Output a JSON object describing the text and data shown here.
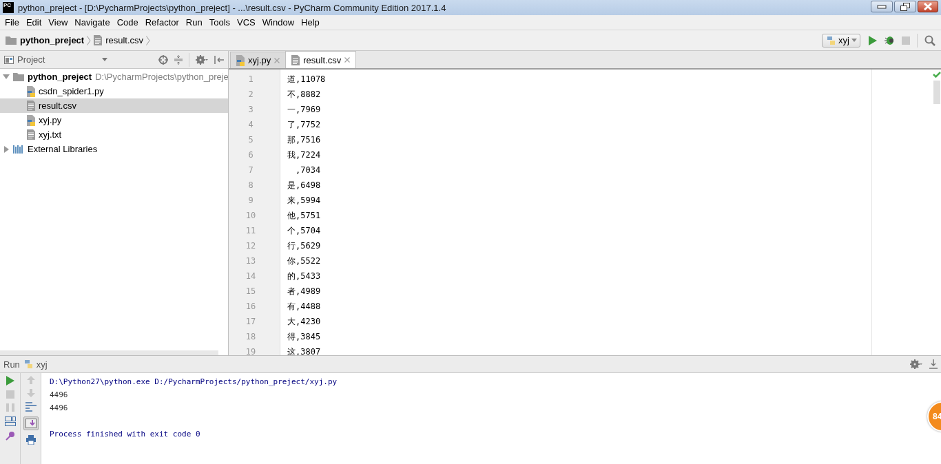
{
  "app_logo": {
    "text": "PC"
  },
  "window": {
    "title": "python_preject - [D:\\PycharmProjects\\python_preject] - ...\\result.csv - PyCharm Community Edition 2017.1.4"
  },
  "menu": [
    {
      "label": "File"
    },
    {
      "label": "Edit"
    },
    {
      "label": "View"
    },
    {
      "label": "Navigate"
    },
    {
      "label": "Code"
    },
    {
      "label": "Refactor"
    },
    {
      "label": "Run"
    },
    {
      "label": "Tools"
    },
    {
      "label": "VCS"
    },
    {
      "label": "Window"
    },
    {
      "label": "Help"
    }
  ],
  "breadcrumbs": [
    {
      "label": "python_preject",
      "kind": "folder"
    },
    {
      "label": "result.csv",
      "kind": "text"
    }
  ],
  "run_config": {
    "label": "xyj"
  },
  "project_panel": {
    "title": "Project",
    "tree": [
      {
        "label": "python_preject",
        "path": "D:\\PycharmProjects\\python_preje",
        "kind": "folder",
        "expanded": true,
        "selected": false,
        "children": [
          {
            "label": "csdn_spider1.py",
            "kind": "python",
            "selected": false
          },
          {
            "label": "result.csv",
            "kind": "text",
            "selected": true
          },
          {
            "label": "xyj.py",
            "kind": "python",
            "selected": false
          },
          {
            "label": "xyj.txt",
            "kind": "text",
            "selected": false
          }
        ]
      },
      {
        "label": "External Libraries",
        "kind": "library",
        "expanded": false,
        "selected": false
      }
    ]
  },
  "editor": {
    "tabs": [
      {
        "label": "xyj.py",
        "kind": "python",
        "selected": false
      },
      {
        "label": "result.csv",
        "kind": "text",
        "selected": true
      }
    ],
    "lines": [
      {
        "number": "1",
        "text": "道,11078"
      },
      {
        "number": "2",
        "text": "不,8882"
      },
      {
        "number": "3",
        "text": "一,7969"
      },
      {
        "number": "4",
        "text": "了,7752"
      },
      {
        "number": "5",
        "text": "那,7516"
      },
      {
        "number": "6",
        "text": "我,7224"
      },
      {
        "number": "7",
        "text": "　,7034"
      },
      {
        "number": "8",
        "text": "是,6498"
      },
      {
        "number": "9",
        "text": "来,5994"
      },
      {
        "number": "10",
        "text": "他,5751"
      },
      {
        "number": "11",
        "text": "个,5704"
      },
      {
        "number": "12",
        "text": "行,5629"
      },
      {
        "number": "13",
        "text": "你,5522"
      },
      {
        "number": "14",
        "text": "的,5433"
      },
      {
        "number": "15",
        "text": "者,4989"
      },
      {
        "number": "16",
        "text": "有,4488"
      },
      {
        "number": "17",
        "text": "大,4230"
      },
      {
        "number": "18",
        "text": "得,3845"
      },
      {
        "number": "19",
        "text": "这,3807"
      }
    ]
  },
  "run_panel": {
    "title": "Run",
    "config": "xyj",
    "output": [
      {
        "kind": "command",
        "text": "D:\\Python27\\python.exe D:/PycharmProjects/python_preject/xyj.py"
      },
      {
        "kind": "stdout",
        "text": "4496"
      },
      {
        "kind": "stdout",
        "text": "4496"
      },
      {
        "kind": "system",
        "text": "Process finished with exit code 0"
      }
    ]
  },
  "floating_badge": {
    "text": "84"
  }
}
